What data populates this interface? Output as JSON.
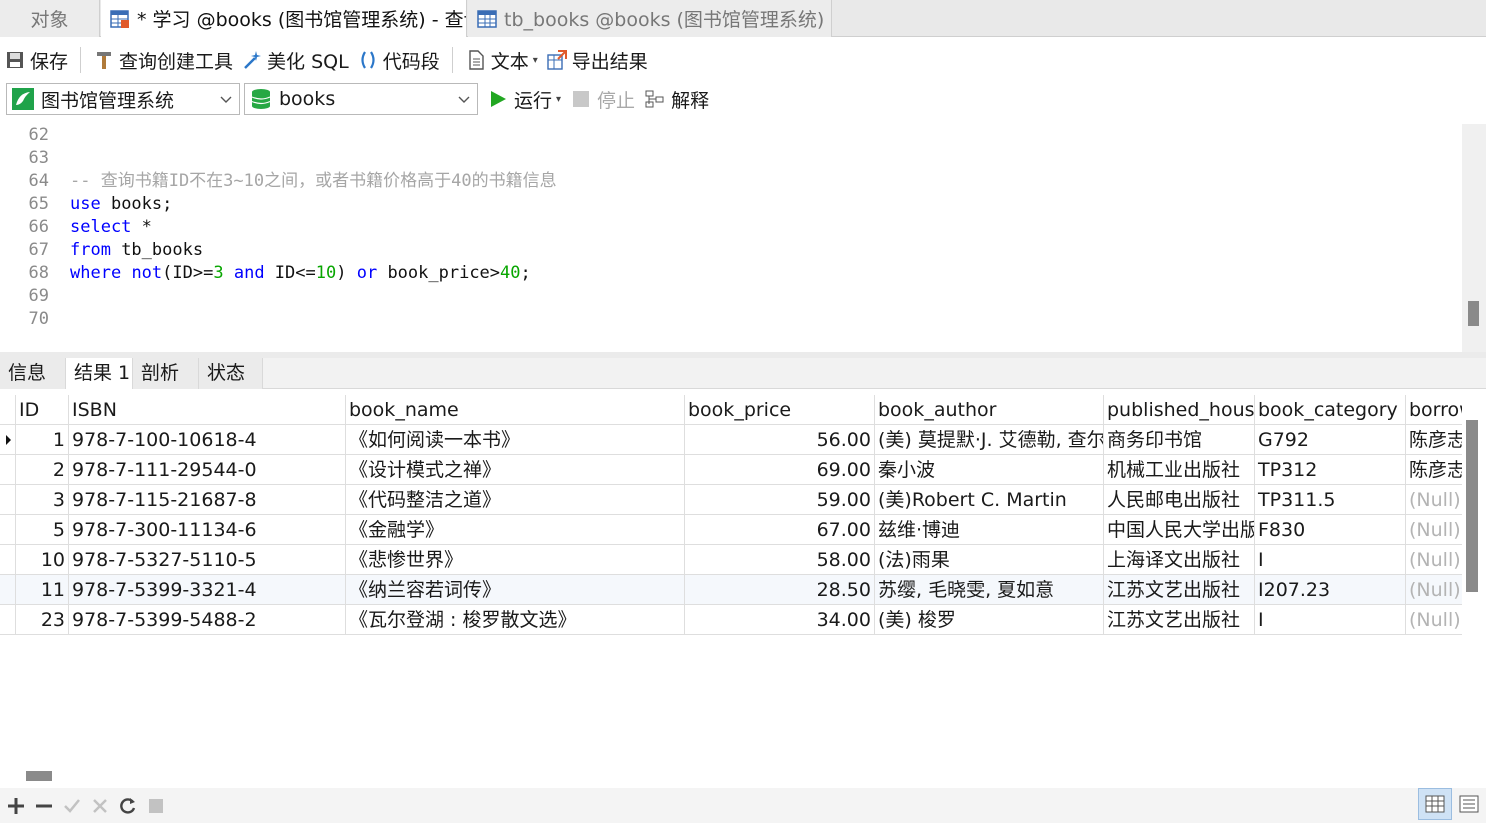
{
  "tabs": {
    "objects": "对象",
    "query": "* 学习 @books (图书馆管理系统) - 查询",
    "table": "tb_books @books (图书馆管理系统) -..."
  },
  "toolbar": {
    "save": "保存",
    "query_builder": "查询创建工具",
    "beautify": "美化 SQL",
    "snippet": "代码段",
    "text": "文本",
    "export": "导出结果"
  },
  "toolbar2": {
    "connection": "图书馆管理系统",
    "database": "books",
    "run": "运行",
    "stop": "停止",
    "explain": "解释"
  },
  "editor": {
    "lines": [
      {
        "n": "62",
        "parts": []
      },
      {
        "n": "63",
        "parts": []
      },
      {
        "n": "64",
        "parts": [
          {
            "t": "-- 查询书籍ID不在3~10之间，或者书籍价格高于40的书籍信息",
            "c": "cm"
          }
        ]
      },
      {
        "n": "65",
        "parts": [
          {
            "t": "use",
            "c": "kw"
          },
          {
            "t": " books;",
            "c": ""
          }
        ]
      },
      {
        "n": "66",
        "parts": [
          {
            "t": "select",
            "c": "kw"
          },
          {
            "t": " *",
            "c": ""
          }
        ]
      },
      {
        "n": "67",
        "parts": [
          {
            "t": "from",
            "c": "kw"
          },
          {
            "t": " tb_books",
            "c": ""
          }
        ]
      },
      {
        "n": "68",
        "parts": [
          {
            "t": "where",
            "c": "kw"
          },
          {
            "t": " ",
            "c": ""
          },
          {
            "t": "not",
            "c": "kw"
          },
          {
            "t": "(ID>=",
            "c": ""
          },
          {
            "t": "3",
            "c": "num"
          },
          {
            "t": " ",
            "c": ""
          },
          {
            "t": "and",
            "c": "kw"
          },
          {
            "t": " ID<=",
            "c": ""
          },
          {
            "t": "10",
            "c": "num"
          },
          {
            "t": ") ",
            "c": ""
          },
          {
            "t": "or",
            "c": "kw"
          },
          {
            "t": " book_price>",
            "c": ""
          },
          {
            "t": "40",
            "c": "num"
          },
          {
            "t": ";",
            "c": ""
          }
        ]
      },
      {
        "n": "69",
        "parts": []
      },
      {
        "n": "70",
        "parts": []
      }
    ]
  },
  "result_tabs": [
    "信息",
    "结果 1",
    "剖析",
    "状态"
  ],
  "grid": {
    "columns": [
      "ID",
      "ISBN",
      "book_name",
      "book_price",
      "book_author",
      "published_house",
      "book_category",
      "borrow"
    ],
    "rows": [
      [
        "1",
        "978-7-100-10618-4",
        "《如何阅读一本书》",
        "56.00",
        "(美) 莫提默·J. 艾德勒, 查尔斯",
        "商务印书馆",
        "G792",
        "陈彦志"
      ],
      [
        "2",
        "978-7-111-29544-0",
        "《设计模式之禅》",
        "69.00",
        "秦小波",
        "机械工业出版社",
        "TP312",
        "陈彦志"
      ],
      [
        "3",
        "978-7-115-21687-8",
        "《代码整洁之道》",
        "59.00",
        "(美)Robert C. Martin",
        "人民邮电出版社",
        "TP311.5",
        "(Null)"
      ],
      [
        "5",
        "978-7-300-11134-6",
        "《金融学》",
        "67.00",
        "兹维·博迪",
        "中国人民大学出版社",
        "F830",
        "(Null)"
      ],
      [
        "10",
        "978-7-5327-5110-5",
        "《悲惨世界》",
        "58.00",
        "(法)雨果",
        "上海译文出版社",
        "I",
        "(Null)"
      ],
      [
        "11",
        "978-7-5399-3321-4",
        "《纳兰容若词传》",
        "28.50",
        "苏缨, 毛晓雯, 夏如意",
        "江苏文艺出版社",
        "I207.23",
        "(Null)"
      ],
      [
        "23",
        "978-7-5399-5488-2",
        "《瓦尔登湖 : 梭罗散文选》",
        "34.00",
        "(美) 梭罗",
        "江苏文艺出版社",
        "I",
        "(Null)"
      ]
    ]
  },
  "colors": {
    "keyword": "#0000ff",
    "comment": "#a6a6a6",
    "number": "#08a600",
    "null_text": "#b4b4b4",
    "run_green": "#22a722"
  }
}
